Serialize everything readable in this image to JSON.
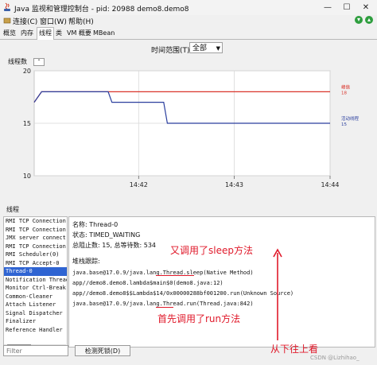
{
  "window": {
    "title": "Java 监视和管理控制台 - pid: 20988 demo8.demo8",
    "controls": [
      "—",
      "☐",
      "✕"
    ]
  },
  "menu": {
    "items": [
      "连接(C)",
      "窗口(W)",
      "帮助(H)"
    ]
  },
  "tabs": [
    "概览",
    "内存",
    "线程",
    "类",
    "VM 概要",
    "MBean"
  ],
  "active_tab": "线程",
  "time_range": {
    "label": "时间范围(T):",
    "value": "全部"
  },
  "chart_header": "线程数",
  "chart_data": {
    "type": "line",
    "x_ticks": [
      "14:42",
      "14:43",
      "14:44"
    ],
    "y_ticks": [
      10,
      15,
      20
    ],
    "ylim": [
      10,
      20
    ],
    "xlim": [
      0,
      40
    ],
    "series": [
      {
        "name": "峰值",
        "value_label": "18",
        "color": "#d9342b",
        "x": [
          0,
          1,
          10,
          40
        ],
        "y": [
          17,
          18,
          18,
          18
        ]
      },
      {
        "name": "活动线程",
        "value_label": "15",
        "color": "#2b3f9e",
        "x": [
          0,
          1,
          10,
          10.5,
          17.5,
          18,
          40
        ],
        "y": [
          17,
          18,
          18,
          17,
          17,
          15,
          15
        ]
      }
    ]
  },
  "threads": {
    "section_title": "线程",
    "list": [
      "RMI TCP Connection",
      "RMI TCP Connection",
      "JMX server connect",
      "RMI TCP Connection",
      "RMI Scheduler(0)",
      "RMI TCP Accept-0",
      "Thread-0",
      "Notification Thread",
      "Monitor Ctrl-Break",
      "Common-Cleaner",
      "Attach Listener",
      "Signal Dispatcher",
      "Finalizer",
      "Reference Handler"
    ],
    "selected_index": 6
  },
  "detail": {
    "name": "名称: Thread-0",
    "state": "状态: TIMED_WAITING",
    "totals": "总阻止数: 15, 总等待数: 534",
    "stack_title": "堆栈跟踪:",
    "stack": [
      "java.base@17.0.9/java.lang.Thread.sleep(Native Method)",
      "app//demo8.demo8.lambda$main$0(demo8.java:12)",
      "app//demo8.demo8$$Lambda$14/0x00000288bf001200.run(Unknown Source)",
      "java.base@17.0.9/java.lang.Thread.run(Thread.java:842)"
    ]
  },
  "filter": {
    "placeholder": "Filter"
  },
  "deadlock_button": "检测死锁(D)",
  "annotations": {
    "sleep_note": "又调用了sleep方法",
    "run_note": "首先调用了run方法",
    "order_note": "从下往上看"
  },
  "watermark": "CSDN @Lizhihao_"
}
